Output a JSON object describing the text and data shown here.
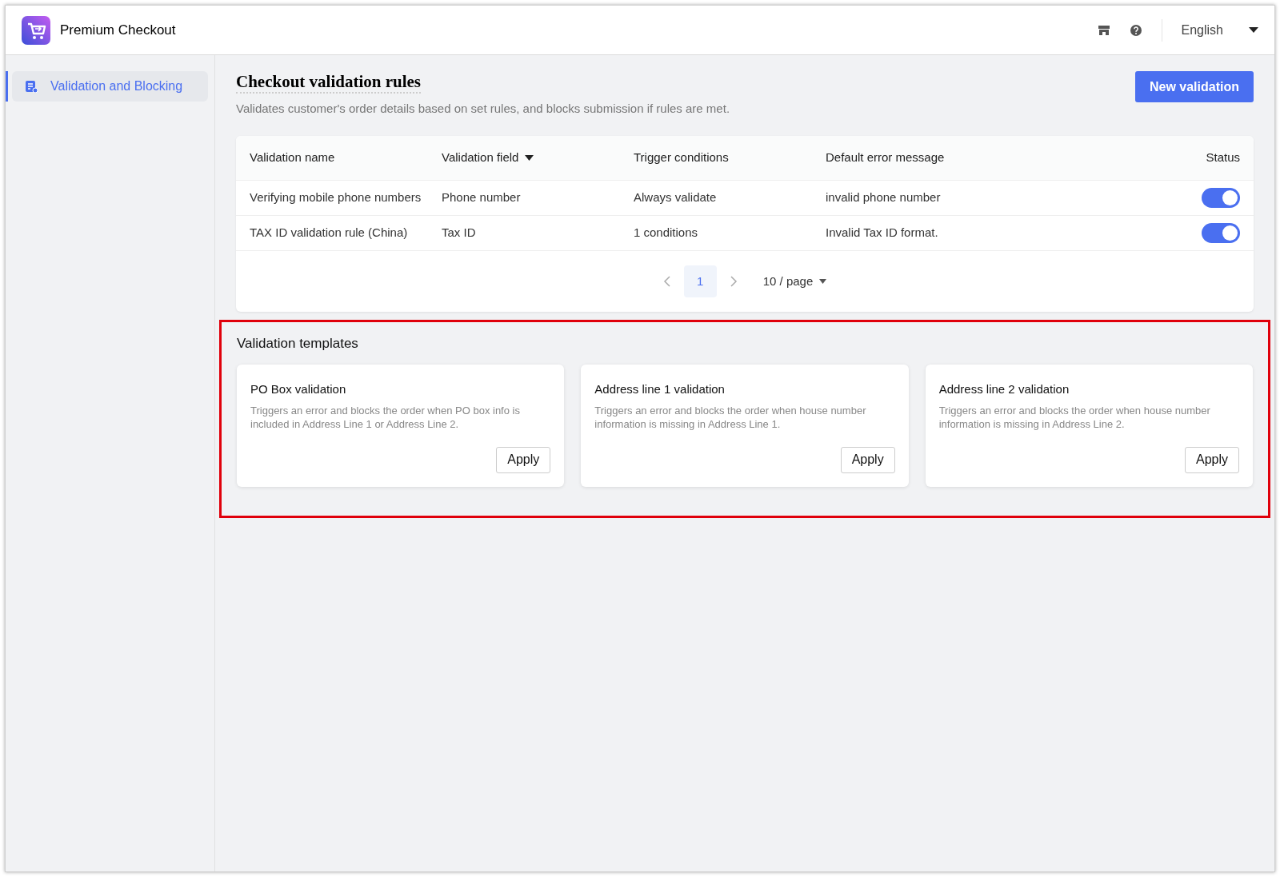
{
  "header": {
    "title": "Premium Checkout",
    "language": "English"
  },
  "sidebar": {
    "items": [
      {
        "label": "Validation and Blocking",
        "selected": true
      }
    ]
  },
  "page": {
    "title": "Checkout validation rules",
    "description": "Validates customer's order details based on set rules, and blocks submission if rules are met.",
    "new_button": "New validation"
  },
  "table": {
    "columns": [
      {
        "label": "Validation name",
        "sortable": false
      },
      {
        "label": "Validation field",
        "sortable": true
      },
      {
        "label": "Trigger conditions",
        "sortable": false
      },
      {
        "label": "Default error message",
        "sortable": false
      },
      {
        "label": "Status",
        "sortable": false
      }
    ],
    "rows": [
      {
        "name": "Verifying mobile phone numbers",
        "field": "Phone number",
        "trigger": "Always validate",
        "message": "invalid phone number",
        "on": true
      },
      {
        "name": "TAX ID validation rule (China)",
        "field": "Tax ID",
        "trigger": "1 conditions",
        "message": "Invalid Tax ID format.",
        "on": true
      }
    ]
  },
  "pagination": {
    "pages": [
      {
        "label": "1",
        "selected": true
      }
    ],
    "page_size": "10 / page"
  },
  "templates": {
    "title": "Validation templates",
    "highlighted": true,
    "cards": [
      {
        "title": "PO Box validation",
        "description": "Triggers an error and blocks the order when PO box info is included in Address Line 1 or Address Line 2.",
        "button": "Apply"
      },
      {
        "title": "Address line 1 validation",
        "description": "Triggers an error and blocks the order when house number information is missing in Address Line 1.",
        "button": "Apply"
      },
      {
        "title": "Address line 2 validation",
        "description": "Triggers an error and blocks the order when house number information is missing in Address Line 2.",
        "button": "Apply"
      }
    ]
  }
}
